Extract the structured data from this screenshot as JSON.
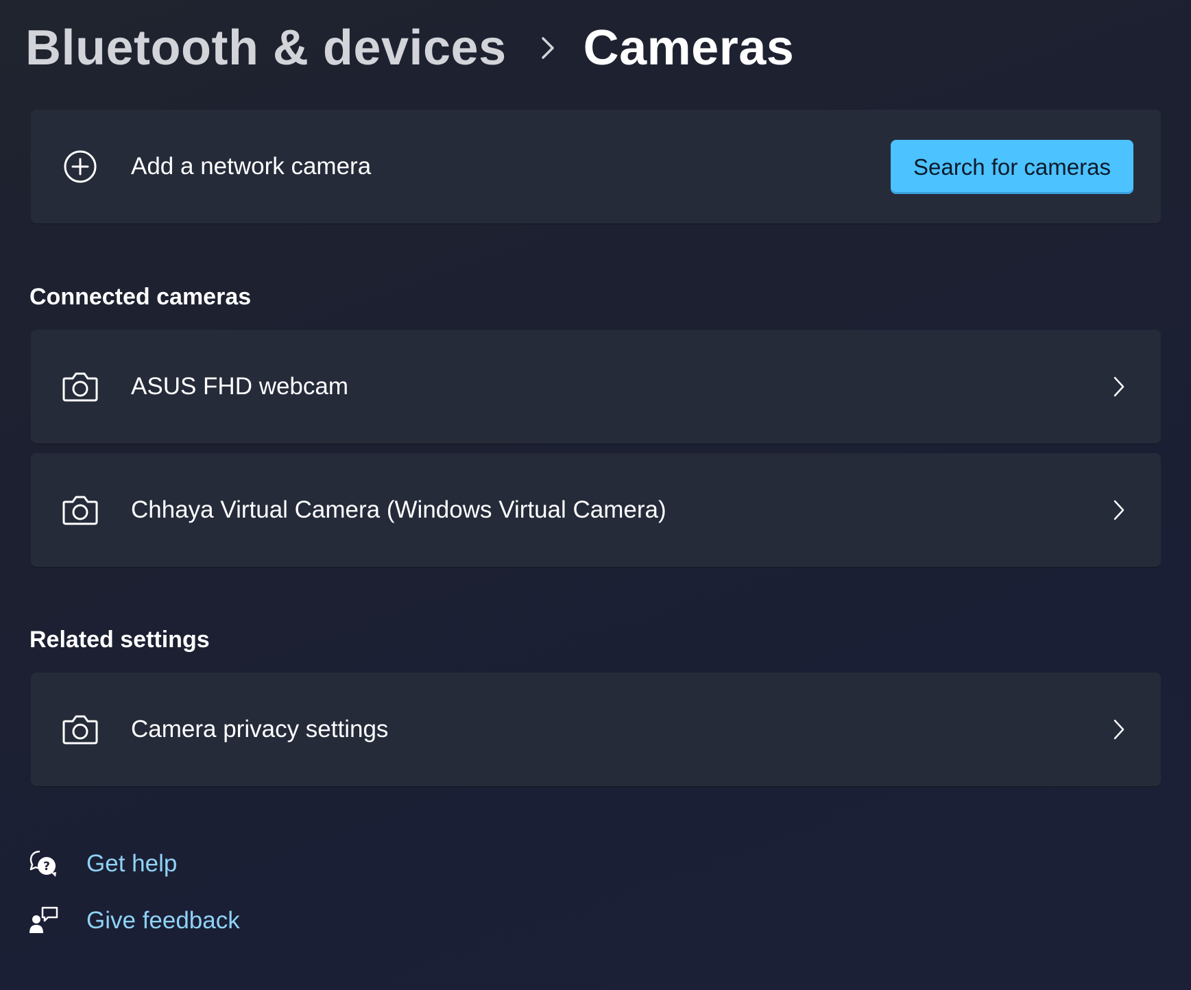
{
  "header": {
    "breadcrumb_parent": "Bluetooth & devices",
    "breadcrumb_current": "Cameras"
  },
  "add_camera": {
    "label": "Add a network camera",
    "button_label": "Search for cameras"
  },
  "connected": {
    "heading": "Connected cameras",
    "items": [
      {
        "label": "ASUS FHD webcam",
        "icon": "camera-icon"
      },
      {
        "label": "Chhaya Virtual Camera (Windows Virtual Camera)",
        "icon": "camera-icon"
      }
    ]
  },
  "related": {
    "heading": "Related settings",
    "items": [
      {
        "label": "Camera privacy settings",
        "icon": "camera-icon"
      }
    ]
  },
  "footer": {
    "get_help": "Get help",
    "give_feedback": "Give feedback"
  },
  "colors": {
    "accent": "#4cc2ff",
    "link": "#8fd3f7",
    "card_background": "#262b3a",
    "page_background": "#1c2030"
  }
}
